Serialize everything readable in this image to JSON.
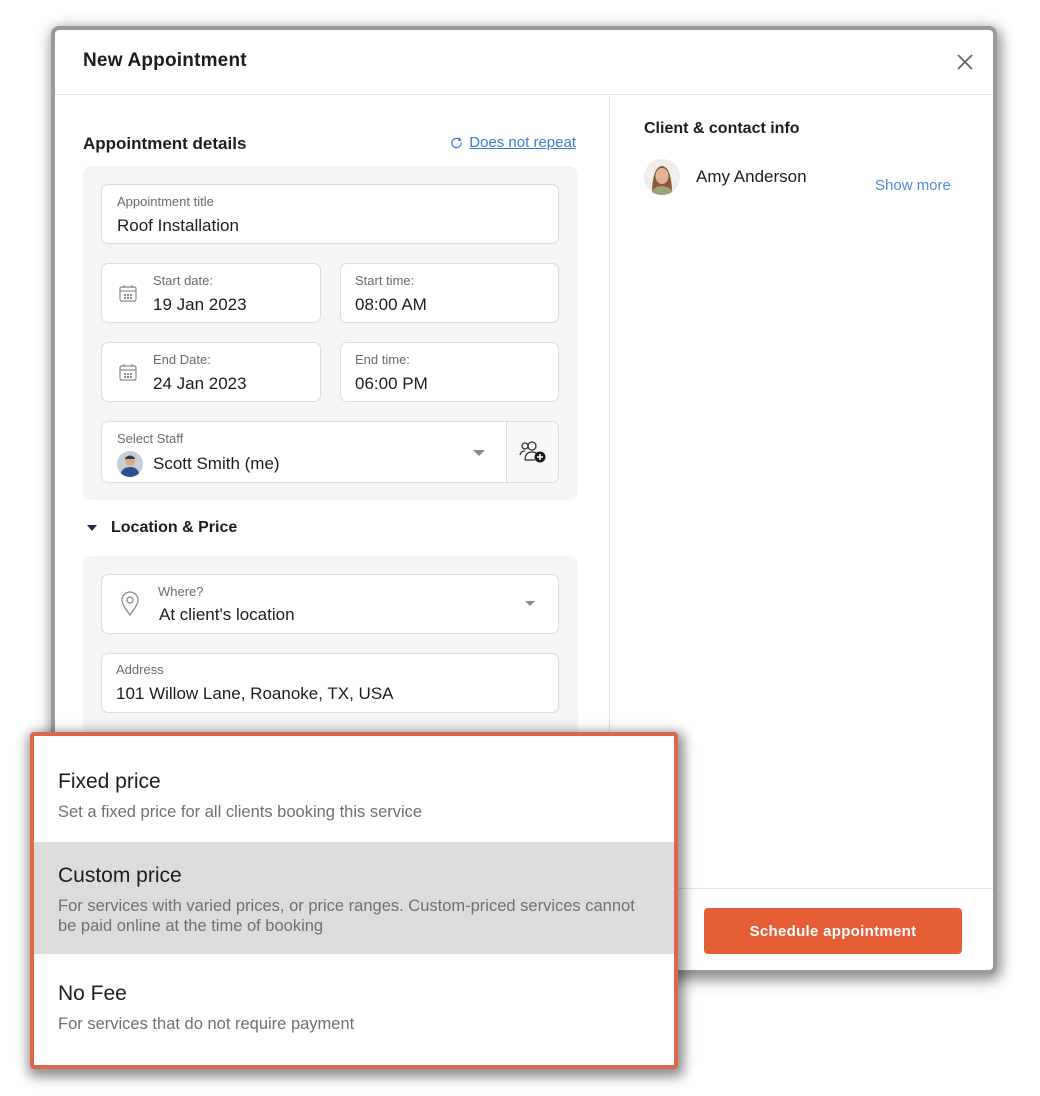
{
  "modal": {
    "title": "New Appointment",
    "close_label": "close"
  },
  "details": {
    "heading": "Appointment details",
    "repeat_link": "Does not repeat",
    "title_field": {
      "label": "Appointment title",
      "value": "Roof Installation"
    },
    "start_date": {
      "label": "Start date:",
      "value": "19 Jan 2023"
    },
    "start_time": {
      "label": "Start time:",
      "value": "08:00 AM"
    },
    "end_date": {
      "label": "End Date:",
      "value": "24 Jan 2023"
    },
    "end_time": {
      "label": "End time:",
      "value": "06:00 PM"
    },
    "staff": {
      "label": "Select Staff",
      "value": "Scott Smith (me)"
    }
  },
  "location_price": {
    "heading": "Location & Price",
    "where": {
      "label": "Where?",
      "value": "At client's location"
    },
    "address": {
      "label": "Address",
      "value": "101 Willow Lane, Roanoke, TX, USA"
    }
  },
  "client": {
    "heading": "Client & contact info",
    "name": "Amy Anderson",
    "show_more": "Show more"
  },
  "footer": {
    "schedule_button": "Schedule appointment"
  },
  "price_options": [
    {
      "title": "Fixed price",
      "description": "Set a fixed price for all clients booking this service",
      "highlighted": false
    },
    {
      "title": "Custom price",
      "description": "For services with varied prices, or price ranges. Custom-priced services cannot be paid online at the time of booking",
      "highlighted": true
    },
    {
      "title": "No Fee",
      "description": "For services that do not require payment",
      "highlighted": false
    }
  ],
  "colors": {
    "accent": "#e65e36",
    "popup_border": "#d9694a",
    "link": "#3a7bd5",
    "highlight_row": "#dcdcdc"
  }
}
